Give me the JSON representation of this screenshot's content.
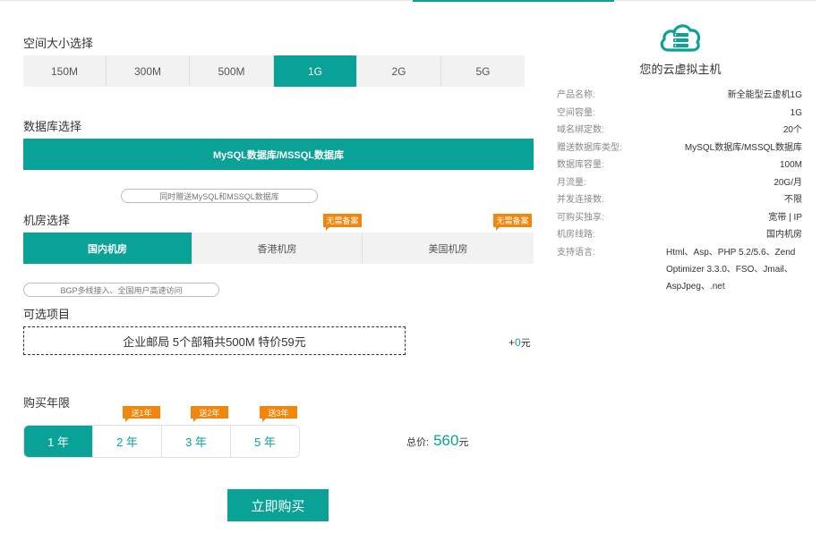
{
  "space": {
    "title": "空间大小选择",
    "options": [
      "150M",
      "300M",
      "500M",
      "1G",
      "2G",
      "5G"
    ],
    "selected": "1G"
  },
  "database": {
    "title": "数据库选择",
    "option": "MySQL数据库/MSSQL数据库",
    "note": "同时赠送MySQL和MSSQL数据库"
  },
  "datacenter": {
    "title": "机房选择",
    "options": [
      "国内机房",
      "香港机房",
      "美国机房"
    ],
    "selected": "国内机房",
    "badge": "无需备案",
    "note": "BGP多线接入、全国用户高速访问"
  },
  "addons": {
    "title": "可选项目",
    "email": "企业邮局 5个部箱共500M 特价59元",
    "price_prefix": "+",
    "price_value": "0",
    "price_unit": "元"
  },
  "duration": {
    "title": "购买年限",
    "options": [
      "1 年",
      "2 年",
      "3 年",
      "5 年"
    ],
    "selected": "1 年",
    "gift_tags": [
      "送1年",
      "送2年",
      "送3年"
    ],
    "total_label": "总价:",
    "total_value": "560",
    "total_unit": "元"
  },
  "buy_button": "立即购买",
  "summary": {
    "icon": "cloud-server-icon",
    "title": "您的云虚拟主机",
    "rows": [
      {
        "k": "产品名称:",
        "v": "新全能型云虚机1G"
      },
      {
        "k": "空间容量:",
        "v": "1G"
      },
      {
        "k": "域名绑定数:",
        "v": "20个"
      },
      {
        "k": "赠送数据库类型:",
        "v": "MySQL数据库/MSSQL数据库"
      },
      {
        "k": "数据库容量:",
        "v": "100M"
      },
      {
        "k": "月流量:",
        "v": "20G/月"
      },
      {
        "k": "并发连接数:",
        "v": "不限"
      },
      {
        "k": "可购买独享:",
        "v": "宽带 | IP"
      },
      {
        "k": "机房线路:",
        "v": "国内机房"
      },
      {
        "k": "支持语言:",
        "v": "Html、Asp、PHP 5.2/5.6、Zend Optimizer 3.3.0、FSO、Jmail、AspJpeg、.net"
      }
    ]
  },
  "colors": {
    "accent": "#0aa197",
    "tag": "#f0860d"
  }
}
